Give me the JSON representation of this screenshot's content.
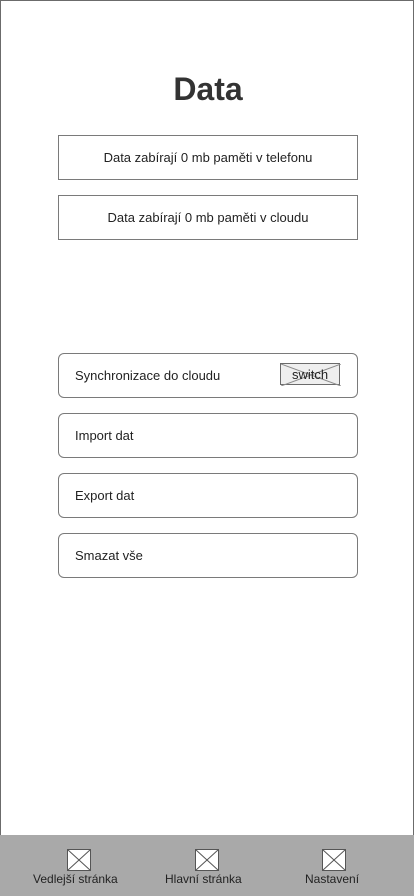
{
  "header": {
    "title": "Data"
  },
  "storage": {
    "phone_text": "Data zabírají 0 mb paměti v telefonu",
    "cloud_text": "Data zabírají 0 mb paměti v cloudu"
  },
  "options": {
    "sync_label": "Synchronizace do cloudu",
    "sync_switch_label": "switch",
    "import_label": "Import dat",
    "export_label": "Export dat",
    "delete_label": "Smazat vše"
  },
  "bottom_nav": {
    "items": [
      {
        "label": "Vedlejší stránka",
        "icon": "image-placeholder-icon"
      },
      {
        "label": "Hlavní stránka",
        "icon": "image-placeholder-icon"
      },
      {
        "label": "Nastavení",
        "icon": "image-placeholder-icon"
      }
    ]
  },
  "colors": {
    "nav_background": "#a9a9a9",
    "border": "#7a7a7a",
    "switch_background": "#efefef"
  }
}
